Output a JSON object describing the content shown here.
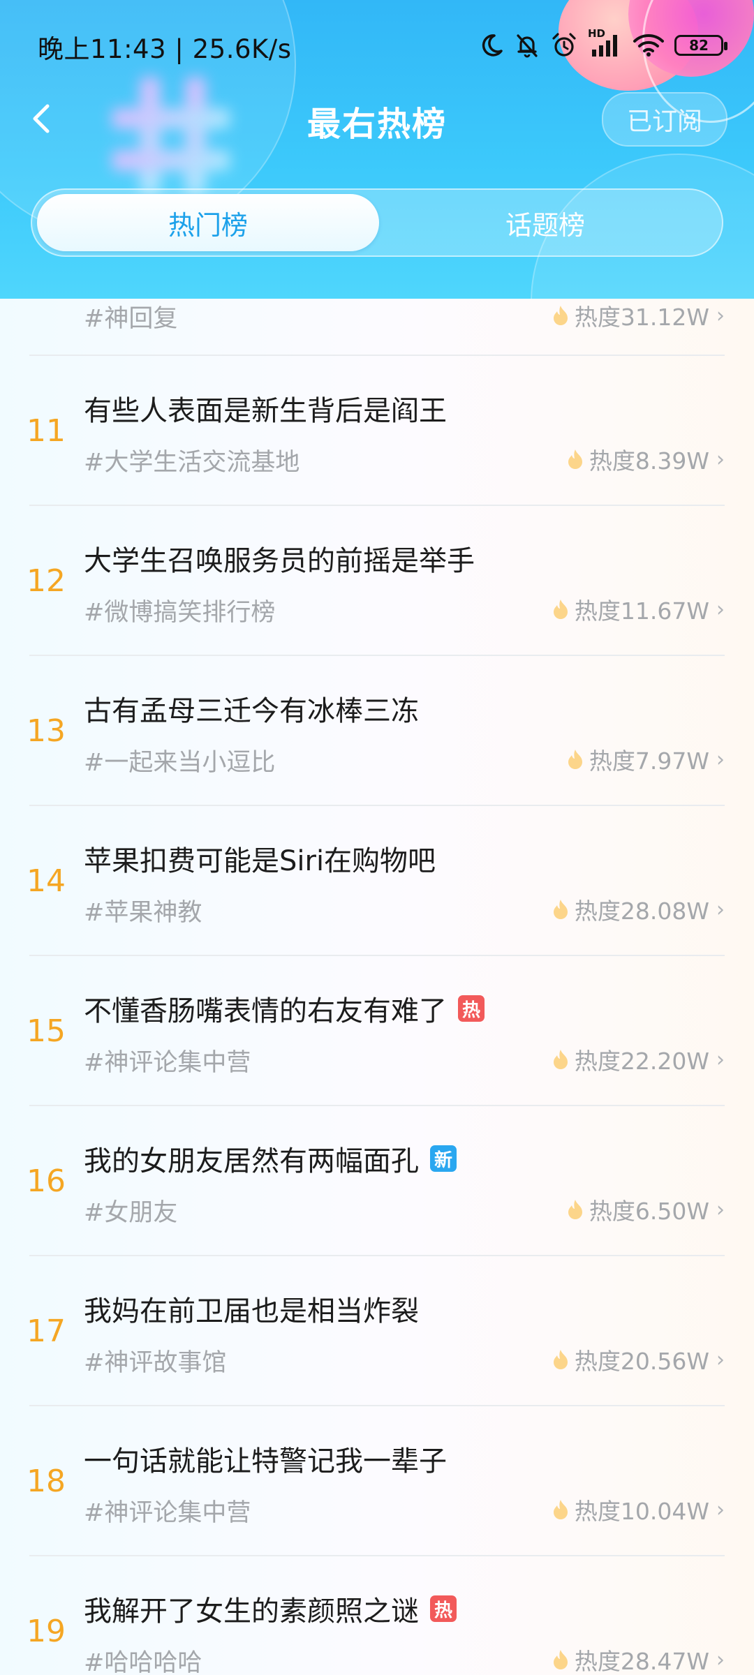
{
  "status_bar": {
    "left_text": "晚上11:43 | 25.6K/s",
    "hd_label": "HD",
    "battery": "82"
  },
  "header": {
    "title": "最右热榜",
    "subscribe_label": "已订阅",
    "tabs": [
      {
        "label": "热门榜",
        "active": true
      },
      {
        "label": "话题榜",
        "active": false
      }
    ]
  },
  "list": {
    "partial_item": {
      "tag": "#神回复",
      "heat": "热度31.12W"
    },
    "items": [
      {
        "rank": "11",
        "title": "有些人表面是新生背后是阎王",
        "badge": "",
        "tag": "#大学生活交流基地",
        "heat": "热度8.39W"
      },
      {
        "rank": "12",
        "title": "大学生召唤服务员的前摇是举手",
        "badge": "",
        "tag": "#微博搞笑排行榜",
        "heat": "热度11.67W"
      },
      {
        "rank": "13",
        "title": "古有孟母三迁今有冰棒三冻",
        "badge": "",
        "tag": "#一起来当小逗比",
        "heat": "热度7.97W"
      },
      {
        "rank": "14",
        "title": "苹果扣费可能是Siri在购物吧",
        "badge": "",
        "tag": "#苹果神教",
        "heat": "热度28.08W"
      },
      {
        "rank": "15",
        "title": "不懂香肠嘴表情的右友有难了",
        "badge": "热",
        "tag": "#神评论集中营",
        "heat": "热度22.20W"
      },
      {
        "rank": "16",
        "title": "我的女朋友居然有两幅面孔",
        "badge": "新",
        "tag": "#女朋友",
        "heat": "热度6.50W"
      },
      {
        "rank": "17",
        "title": "我妈在前卫届也是相当炸裂",
        "badge": "",
        "tag": "#神评故事馆",
        "heat": "热度20.56W"
      },
      {
        "rank": "18",
        "title": "一句话就能让特警记我一辈子",
        "badge": "",
        "tag": "#神评论集中营",
        "heat": "热度10.04W"
      },
      {
        "rank": "19",
        "title": "我解开了女生的素颜照之谜",
        "badge": "热",
        "tag": "#哈哈哈哈",
        "heat": "热度28.47W"
      }
    ]
  },
  "colors": {
    "header_blue": "#3cc9fb",
    "rank_orange": "#f5a623",
    "badge_hot": "#f25a5a",
    "badge_new": "#2aa7f0",
    "active_tab_text": "#1ca1ea"
  },
  "icons": [
    "back-arrow-icon",
    "moon-icon",
    "mute-bell-icon",
    "alarm-icon",
    "signal-icon",
    "wifi-icon",
    "battery-icon",
    "flame-icon",
    "chevron-right-icon"
  ]
}
